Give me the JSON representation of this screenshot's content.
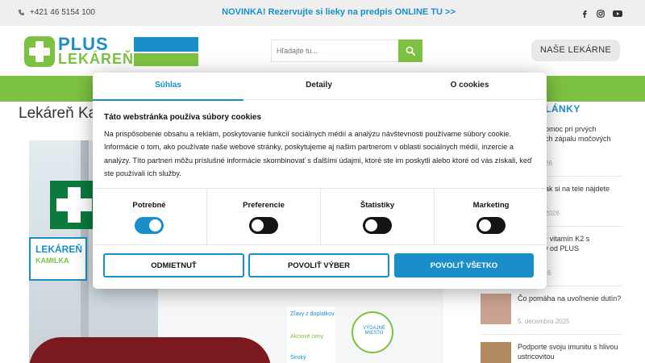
{
  "topbar": {
    "phone": "+421 46 5154 100",
    "promo": "NOVINKA! Rezervujte si lieky na predpis ONLINE TU >>",
    "social": [
      "facebook-icon",
      "instagram-icon",
      "youtube-icon"
    ]
  },
  "header": {
    "logo_word1": "PLUS",
    "logo_word2": "LEKÁREŇ",
    "search_placeholder": "Hľadajte tu...",
    "nase_lekarne": "NAŠE LEKÁRNE"
  },
  "page": {
    "title": "Lekáreň Ka",
    "hero": {
      "sign_title": "LEKÁREŇ",
      "sign_sub": "KAMILKA",
      "store_text1": "Zľavy z doplatkov",
      "store_text2": "Akciové ceny",
      "store_text3": "Široký",
      "circle_text": "VÝDAJNÉ MIESTO"
    }
  },
  "sidebar": {
    "heading": "LÁNKY",
    "articles": [
      {
        "title": "omoc pri prvých\nch zápalu močových",
        "date": "26"
      },
      {
        "title": "ak si na tele nájdete",
        "date": "2026"
      },
      {
        "title": "sirup + vitamín K2 s\nvanilky od PLUS\nE",
        "date": "bra 2026"
      },
      {
        "title": "Čo pomáha na uvoľnenie dutín?",
        "date": "5. decembra 2025"
      },
      {
        "title": "Podporte svoju imunitu s hlivou ustricovitou",
        "date": ""
      }
    ]
  },
  "cookie": {
    "tabs": [
      "Súhlas",
      "Detaily",
      "O cookies"
    ],
    "active_tab": 0,
    "title": "Táto webstránka používa súbory cookies",
    "body": "Na prispôsobenie obsahu a reklám, poskytovanie funkcií sociálnych médií a analýzu návštevnosti používame súbory cookie. Informácie o tom, ako používate naše webové stránky, poskytujeme aj našim partnerom v oblasti sociálnych médií, inzercie a analýzy. Títo partneri môžu príslušné informácie skombinovať s ďalšími údajmi, ktoré ste im poskytli alebo ktoré od vás získali, keď ste používali ich služby.",
    "toggles": [
      {
        "label": "Potrebné",
        "on": true
      },
      {
        "label": "Preferencie",
        "on": false
      },
      {
        "label": "Štatistiky",
        "on": false
      },
      {
        "label": "Marketing",
        "on": false
      }
    ],
    "buttons": {
      "deny": "ODMIETNUŤ",
      "selection": "POVOLIŤ VÝBER",
      "all": "POVOLIŤ VŠETKO"
    }
  },
  "colors": {
    "brand_blue": "#1a8ec8",
    "brand_green": "#7dc142",
    "toggle_off": "#141414"
  }
}
